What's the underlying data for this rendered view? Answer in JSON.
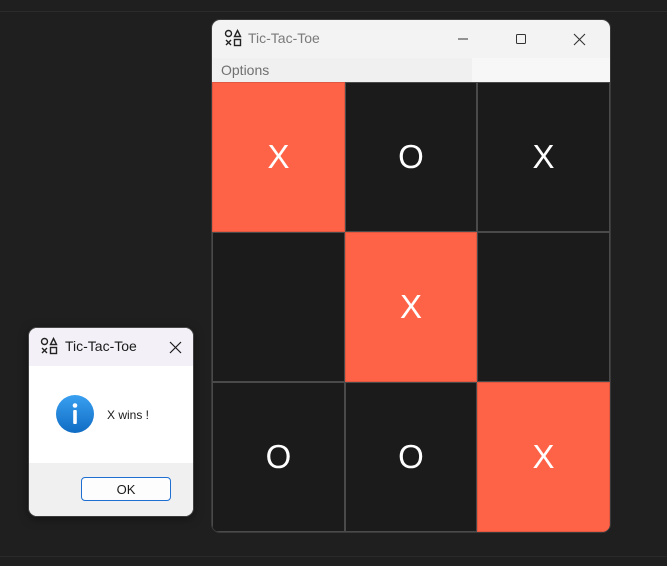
{
  "main_window": {
    "title": "Tic-Tac-Toe",
    "menu": [
      "Options"
    ],
    "board": [
      {
        "mark": "X",
        "win": true
      },
      {
        "mark": "O",
        "win": false
      },
      {
        "mark": "X",
        "win": false
      },
      {
        "mark": "",
        "win": false
      },
      {
        "mark": "X",
        "win": true
      },
      {
        "mark": "",
        "win": false
      },
      {
        "mark": "O",
        "win": false
      },
      {
        "mark": "O",
        "win": false
      },
      {
        "mark": "X",
        "win": true
      }
    ]
  },
  "dialog": {
    "title": "Tic-Tac-Toe",
    "message": "X wins !",
    "ok_label": "OK"
  },
  "colors": {
    "win_cell": "#ff6347",
    "empty_cell": "#1b1b1b",
    "info_blue": "#1a7fd8",
    "ok_border": "#1e6fd1"
  },
  "icons": {
    "app": "tic-tac-toe-icon",
    "minimize": "minimize-icon",
    "maximize": "maximize-icon",
    "close": "close-icon",
    "info": "info-icon"
  }
}
